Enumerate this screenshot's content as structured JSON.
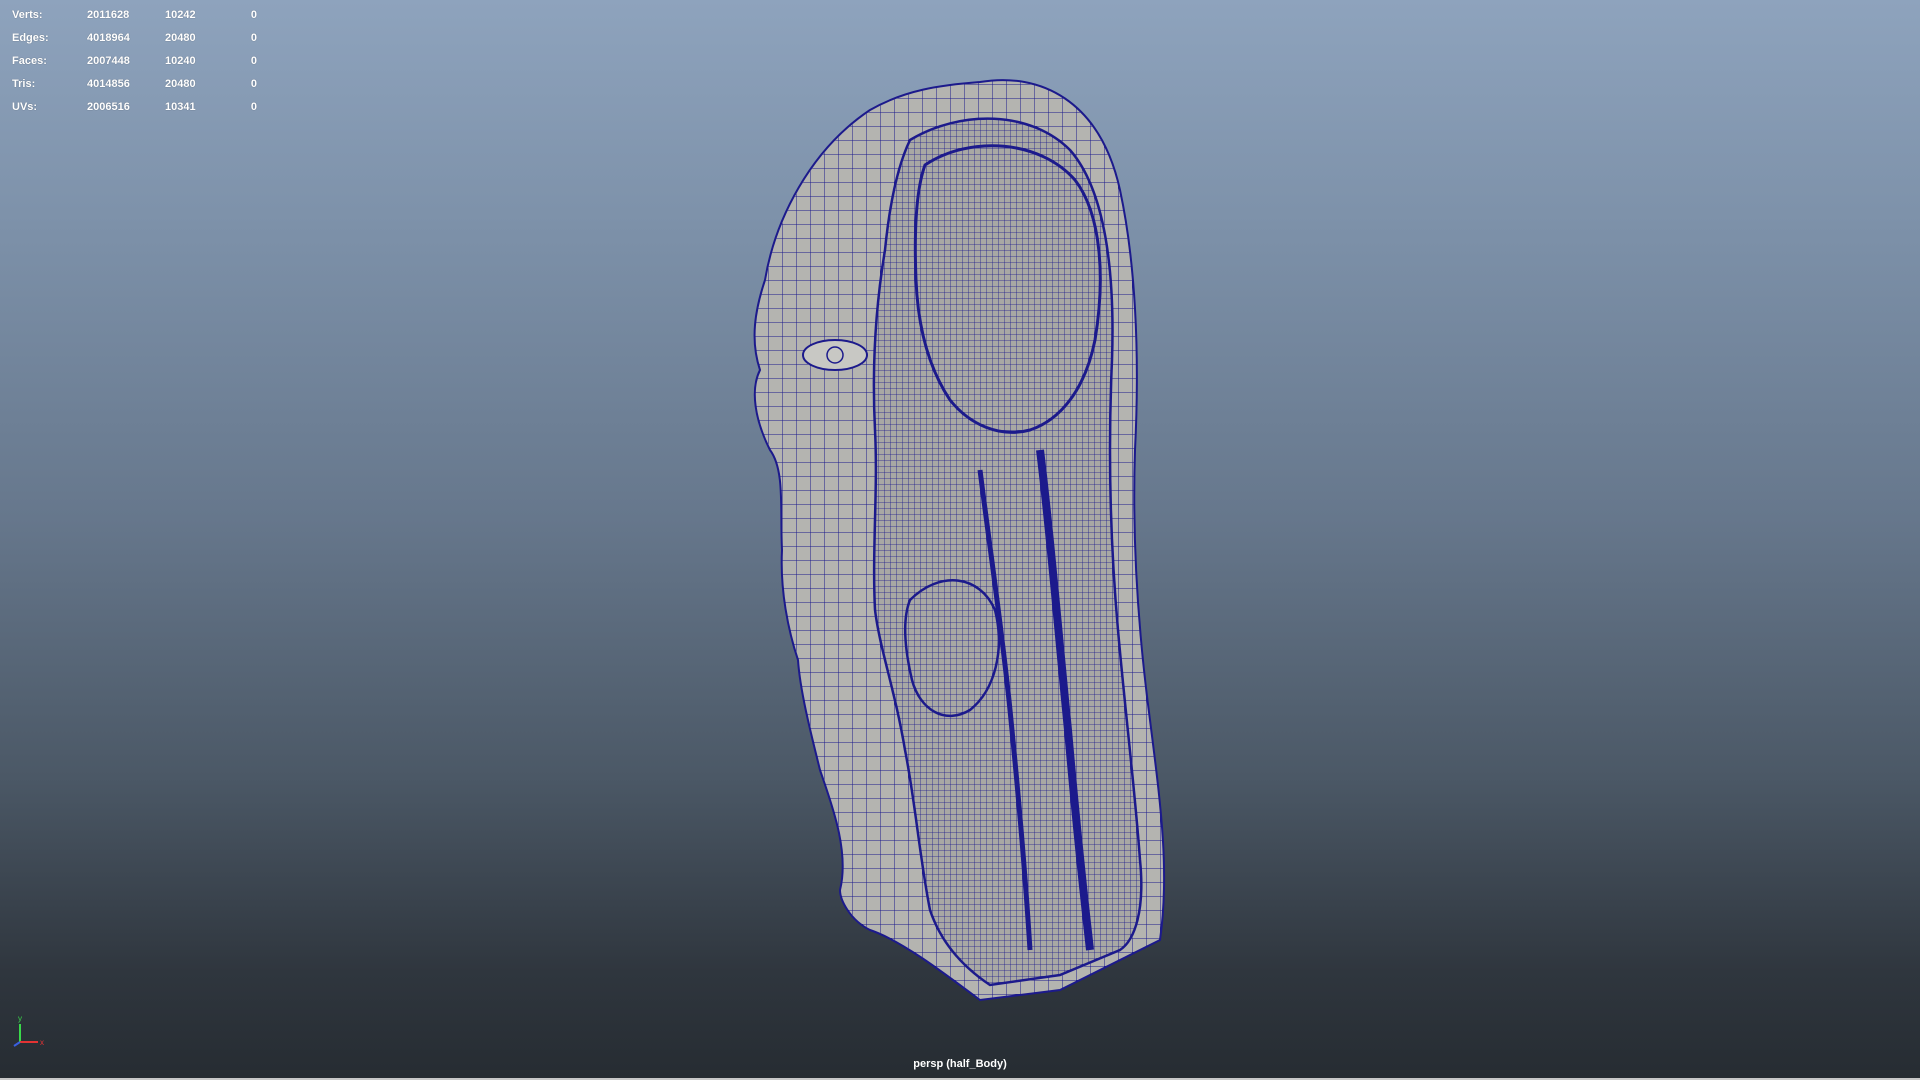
{
  "hud": {
    "rows": [
      {
        "label": "Verts:",
        "v1": "2011628",
        "v2": "10242",
        "v3": "0"
      },
      {
        "label": "Edges:",
        "v1": "4018964",
        "v2": "20480",
        "v3": "0"
      },
      {
        "label": "Faces:",
        "v1": "2007448",
        "v2": "10240",
        "v3": "0"
      },
      {
        "label": "Tris:",
        "v1": "4014856",
        "v2": "20480",
        "v3": "0"
      },
      {
        "label": "UVs:",
        "v1": "2006516",
        "v2": "10341",
        "v3": "0"
      }
    ]
  },
  "viewport": {
    "camera_label": "persp (half_Body)",
    "axis_y_label": "y",
    "axis_x_label": "x",
    "colors": {
      "wireframe": "#1c1a8c",
      "surface": "#b4b4b0",
      "bg_top": "#8ea3bd",
      "bg_bottom": "#262c32"
    }
  }
}
